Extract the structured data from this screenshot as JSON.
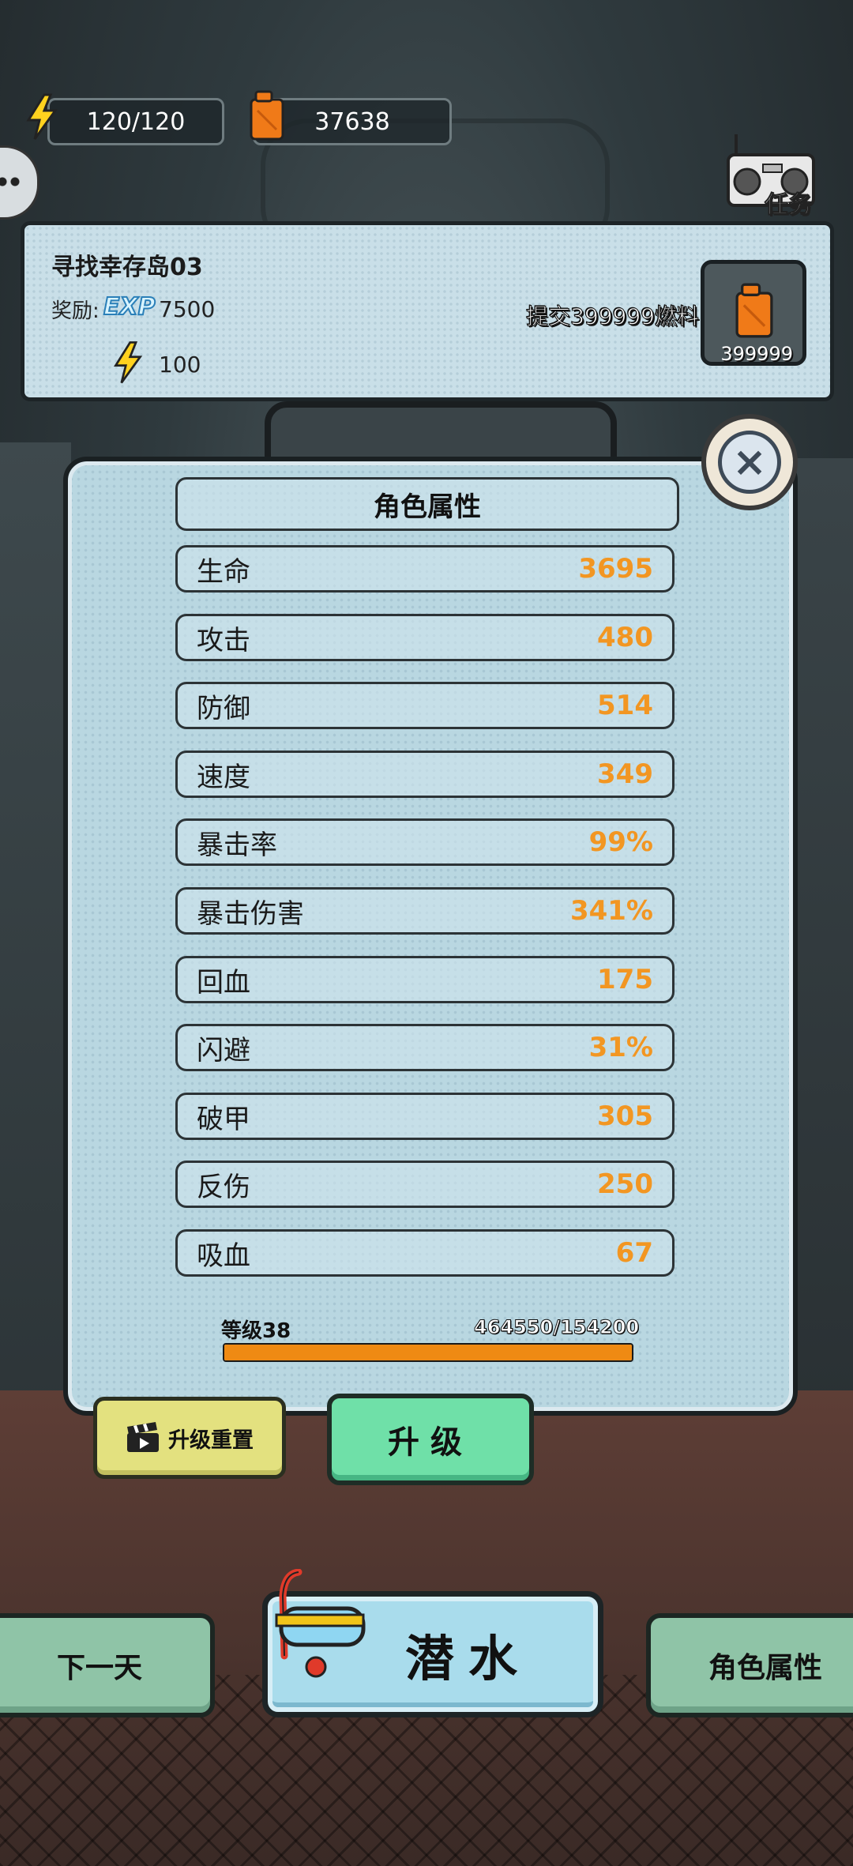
{
  "resources": {
    "energy": "120/120",
    "fuel": "37638"
  },
  "task_button": {
    "label": "任务",
    "icon": "radio-icon"
  },
  "task": {
    "title": "寻找幸存岛03",
    "reward_label": "奖励:",
    "exp_badge": "EXP",
    "exp_value": "7500",
    "energy_value": "100",
    "submit_text": "提交399999燃料",
    "required_count": "399999"
  },
  "attributes_panel": {
    "title": "角色属性",
    "stats": [
      {
        "name": "生命",
        "value": "3695"
      },
      {
        "name": "攻击",
        "value": "480"
      },
      {
        "name": "防御",
        "value": "514"
      },
      {
        "name": "速度",
        "value": "349"
      },
      {
        "name": "暴击率",
        "value": "99%"
      },
      {
        "name": "暴击伤害",
        "value": "341%"
      },
      {
        "name": "回血",
        "value": "175"
      },
      {
        "name": "闪避",
        "value": "31%"
      },
      {
        "name": "破甲",
        "value": "305"
      },
      {
        "name": "反伤",
        "value": "250"
      },
      {
        "name": "吸血",
        "value": "67"
      }
    ],
    "level": "等级38",
    "exp_text": "464550/154200",
    "exp_progress": 1.0,
    "reset_label": "升级重置",
    "upgrade_label": "升级"
  },
  "bottom_bar": {
    "next_day": "下一天",
    "dive": "潜水",
    "role_attr": "角色属性"
  },
  "colors": {
    "stat_value": "#f29622",
    "exp_fill": "#ef8a13",
    "upgrade_green": "#6fe0a8",
    "reset_yellow": "#e3e17f",
    "panel_blue": "#b9d7e1"
  }
}
